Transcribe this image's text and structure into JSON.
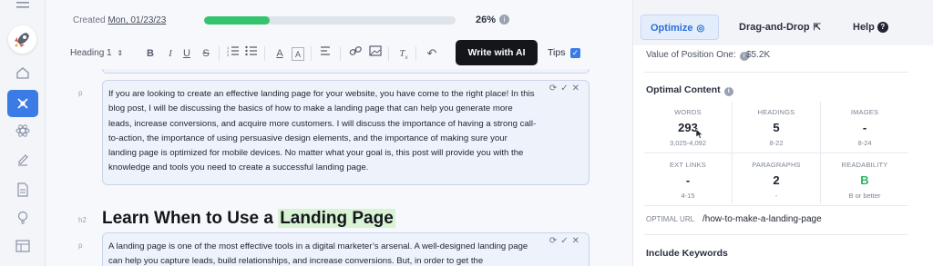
{
  "topbar": {
    "created_label": "Created",
    "created_date": "Mon, 01/23/23",
    "progress_fraction": 0.26,
    "progress_text": "26%"
  },
  "toolbar": {
    "heading_select": "Heading 1",
    "bold": "B",
    "italic": "I",
    "underline": "U",
    "strike": "S",
    "font_color": "A",
    "highlight": "A",
    "clear_format": "T",
    "write_ai_label": "Write with AI",
    "tips_label": "Tips",
    "tips_checked": true
  },
  "editor": {
    "blocks": [
      {
        "tag": "p",
        "text": "If you are looking to create an effective landing page for your website, you have come to the right place! In this blog post, I will be discussing the basics of how to make a landing page that can help you generate more leads, increase conversions, and acquire more customers. I will discuss the importance of having a strong call-to-action, the importance of using persuasive design elements, and the importance of making sure your landing page is optimized for mobile devices. No matter what your goal is, this post will provide you with the knowledge and tools you need to create a successful landing page."
      },
      {
        "tag": "h2",
        "text_plain": "Learn When to Use a ",
        "text_highlight": "Landing Page"
      },
      {
        "tag": "p",
        "text": "A landing page is one of the most effective tools in a digital marketer’s arsenal. A well-designed landing page can help you capture leads, build relationships, and increase conversions. But, in order to get the"
      }
    ]
  },
  "panel": {
    "tabs": [
      {
        "label": "Optimize",
        "active": true
      },
      {
        "label": "Drag-and-Drop",
        "active": false
      },
      {
        "label": "Help",
        "active": false
      }
    ],
    "value_of_position_label": "Value of Position One:",
    "value_of_position_value": "$5.2K",
    "optimal_content_title": "Optimal Content",
    "stats": [
      {
        "label": "WORDS",
        "value": "293",
        "range": "3,025-4,092"
      },
      {
        "label": "HEADINGS",
        "value": "5",
        "range": "8-22"
      },
      {
        "label": "IMAGES",
        "value": "-",
        "range": "8-24"
      },
      {
        "label": "EXT LINKS",
        "value": "-",
        "range": "4-15"
      },
      {
        "label": "PARAGRAPHS",
        "value": "2",
        "range": "-"
      },
      {
        "label": "READABILITY",
        "value": "B",
        "range": "B or better"
      }
    ],
    "optimal_url_label": "OPTIMAL URL",
    "optimal_url_value": "/how-to-make-a-landing-page",
    "include_keywords_title": "Include Keywords"
  },
  "colors": {
    "accent": "#3a7be6",
    "progress": "#35c46e",
    "readability_good": "#2fb364",
    "highlight": "#d8f2d4"
  }
}
